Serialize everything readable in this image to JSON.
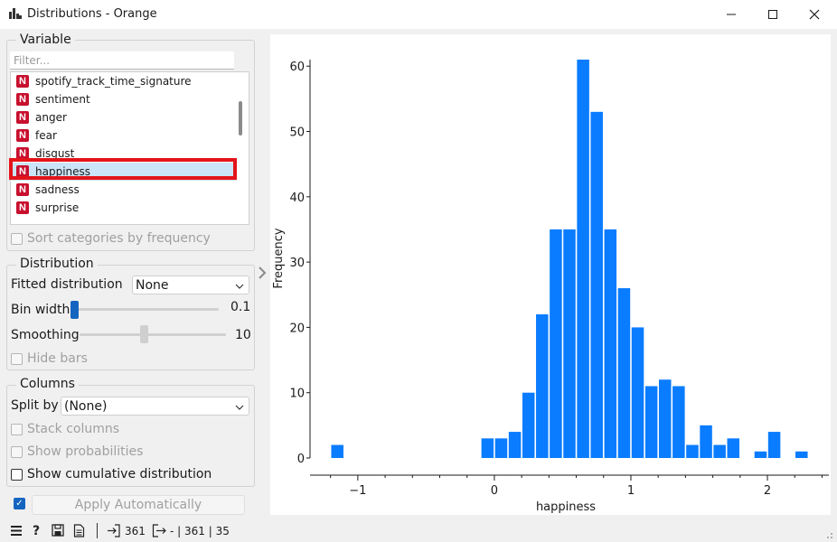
{
  "window": {
    "title": "Distributions - Orange",
    "icons": {
      "app": "bar-chart-icon",
      "minimize": "minimize-icon",
      "maximize": "maximize-icon",
      "close": "close-icon"
    }
  },
  "variable_box": {
    "title": "Variable",
    "filter_placeholder": "Filter...",
    "items": [
      {
        "badge": "N",
        "label": "spotify_track_time_signature"
      },
      {
        "badge": "N",
        "label": "sentiment"
      },
      {
        "badge": "N",
        "label": "anger"
      },
      {
        "badge": "N",
        "label": "fear"
      },
      {
        "badge": "N",
        "label": "disgust"
      },
      {
        "badge": "N",
        "label": "happiness"
      },
      {
        "badge": "N",
        "label": "sadness"
      },
      {
        "badge": "N",
        "label": "surprise"
      }
    ],
    "selected_item": "happiness",
    "sort_label": "Sort categories by frequency"
  },
  "distribution_box": {
    "title": "Distribution",
    "fitted_label": "Fitted distribution",
    "fitted_value": "None",
    "bin_width_label": "Bin width",
    "bin_width_value": "0.1",
    "smoothing_label": "Smoothing",
    "smoothing_value": "10",
    "hide_bars_label": "Hide bars"
  },
  "columns_box": {
    "title": "Columns",
    "split_by_label": "Split by",
    "split_by_value": "(None)",
    "stack_label": "Stack columns",
    "prob_label": "Show probabilities",
    "cumulative_label": "Show cumulative distribution"
  },
  "apply": {
    "label": "Apply Automatically",
    "checked": true
  },
  "status": {
    "input_count": "361",
    "output_text": "- | 361 | 35"
  },
  "colors": {
    "bar": "#0a7cff",
    "accent": "#1565c0",
    "highlight": "#e3141a",
    "badge": "#c8102e"
  },
  "chart_data": {
    "type": "bar",
    "xlabel": "happiness",
    "ylabel": "Frequency",
    "bin_width": 0.1,
    "xlim": [
      -1.35,
      2.45
    ],
    "ylim": [
      0,
      61
    ],
    "x_ticks": [
      -1,
      0,
      1,
      2
    ],
    "y_ticks": [
      0,
      10,
      20,
      30,
      40,
      50,
      60
    ],
    "grid": false,
    "bins": [
      {
        "x": -1.2,
        "count": 2
      },
      {
        "x": -0.1,
        "count": 3
      },
      {
        "x": 0.0,
        "count": 3
      },
      {
        "x": 0.1,
        "count": 4
      },
      {
        "x": 0.2,
        "count": 10
      },
      {
        "x": 0.3,
        "count": 22
      },
      {
        "x": 0.4,
        "count": 35
      },
      {
        "x": 0.5,
        "count": 35
      },
      {
        "x": 0.6,
        "count": 61
      },
      {
        "x": 0.7,
        "count": 53
      },
      {
        "x": 0.8,
        "count": 35
      },
      {
        "x": 0.9,
        "count": 26
      },
      {
        "x": 1.0,
        "count": 20
      },
      {
        "x": 1.1,
        "count": 11
      },
      {
        "x": 1.2,
        "count": 12
      },
      {
        "x": 1.3,
        "count": 11
      },
      {
        "x": 1.4,
        "count": 2
      },
      {
        "x": 1.5,
        "count": 5
      },
      {
        "x": 1.6,
        "count": 2
      },
      {
        "x": 1.7,
        "count": 3
      },
      {
        "x": 1.9,
        "count": 1
      },
      {
        "x": 2.0,
        "count": 4
      },
      {
        "x": 2.2,
        "count": 1
      }
    ]
  }
}
